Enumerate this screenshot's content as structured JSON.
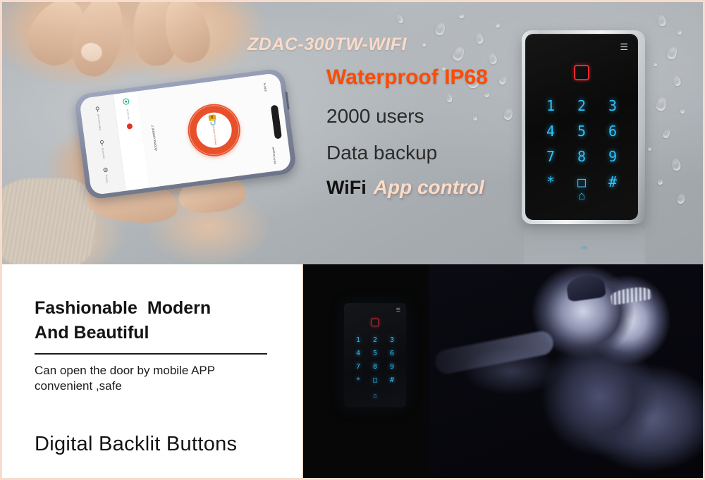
{
  "product": {
    "model_number": "ZDAC-300TW-WIFI",
    "features": [
      "Waterproof IP68",
      "2000 users",
      "Data backup"
    ],
    "wifi_label": "WiFi",
    "app_control_label": "App control"
  },
  "colors": {
    "accent_orange": "#fb4c06",
    "peach": "#fadbc8",
    "keypad_cyan": "#2ec2fb",
    "card_red": "#e8282d",
    "app_orange": "#e8502a",
    "border": "#f7dccd",
    "panel_dark": "#070707"
  },
  "keypad": {
    "wifi_icon": "wifi-icon",
    "card_reader_icon": "card-reader-icon",
    "keys": [
      "1",
      "2",
      "3",
      "4",
      "5",
      "6",
      "7",
      "8",
      "9",
      "*",
      "□",
      "#"
    ],
    "bell_icon": "bell-icon",
    "bell_glyph": "⌂"
  },
  "phone_app": {
    "screen_title": "Access control 7",
    "unlock_button_label": "Press to Unlock",
    "lock_icon": "unlock-padlock-icon",
    "rail_items": [
      {
        "icon": "key-icon",
        "label": "Add Password"
      },
      {
        "icon": "fingerprint-icon",
        "label": "Add RFID"
      },
      {
        "icon": "gear-icon",
        "label": "Setting"
      }
    ],
    "status_online": "Online",
    "status_offline": "No Disturb",
    "battery_label": "4 90 %",
    "signal_label": "Wi-Fi Keypad"
  },
  "bottom_left": {
    "heading_line1_a": "Fashionable",
    "heading_line1_b": "Modern",
    "heading_line2": "And Beautiful",
    "sub_line1": "Can open the door by mobile APP",
    "sub_line2": "convenient ,safe",
    "claim": "Digital Backlit Buttons"
  },
  "bottom_right": {
    "scene_description": "night-couple-photo"
  }
}
